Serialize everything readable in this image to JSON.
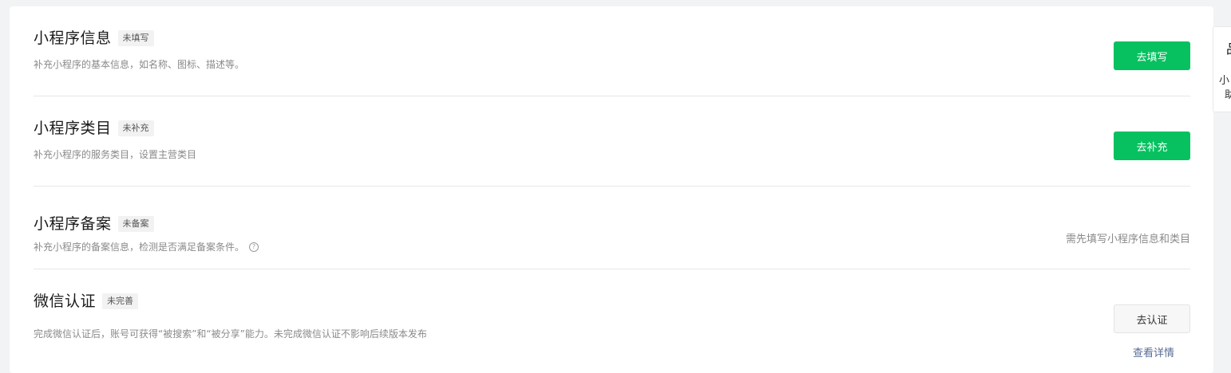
{
  "items": [
    {
      "title": "小程序信息",
      "badge": "未填写",
      "desc": "补充小程序的基本信息，如名称、图标、描述等。",
      "action": "去填写"
    },
    {
      "title": "小程序类目",
      "badge": "未补充",
      "desc": "补充小程序的服务类目，设置主营类目",
      "action": "去补充"
    },
    {
      "title": "小程序备案",
      "badge": "未备案",
      "desc": "补充小程序的备案信息，检测是否满足备案条件。",
      "note": "需先填写小程序信息和类目"
    },
    {
      "title": "微信认证",
      "badge": "未完善",
      "desc": "完成微信认证后，账号可获得“被搜索”和“被分享”能力。未完成微信认证不影响后续版本发布",
      "action": "去认证",
      "link": "查看详情"
    }
  ],
  "float_tab": {
    "icon": "品",
    "line1": "小",
    "line2": "助"
  },
  "colors": {
    "primary": "#07c160",
    "link": "#576b95",
    "muted": "#8a8a8a"
  },
  "icons": {
    "help": "question-circle-icon"
  }
}
